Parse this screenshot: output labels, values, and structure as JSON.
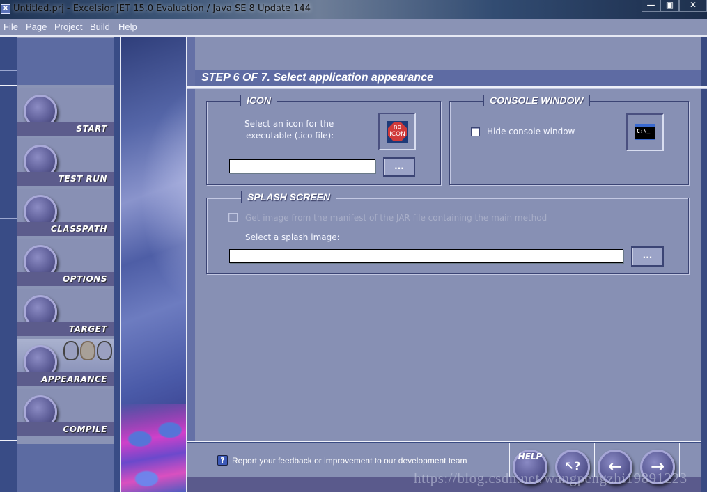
{
  "window": {
    "title": "Untitled.prj - Excelsior JET 15.0 Evaluation / Java SE 8 Update 144",
    "app_icon_glyph": "X",
    "controls": {
      "minimize": "—",
      "maximize": "▣",
      "close": "✕"
    }
  },
  "menu": [
    "File",
    "Page",
    "Project",
    "Build",
    "Help"
  ],
  "sidebar": {
    "items": [
      {
        "label": "START",
        "active": false
      },
      {
        "label": "TEST RUN",
        "active": false
      },
      {
        "label": "CLASSPATH",
        "active": false
      },
      {
        "label": "OPTIONS",
        "active": false
      },
      {
        "label": "TARGET",
        "active": false
      },
      {
        "label": "APPEARANCE",
        "active": true
      },
      {
        "label": "COMPILE",
        "active": false
      }
    ]
  },
  "step": {
    "title": "STEP 6 OF 7. Select application appearance"
  },
  "icon_group": {
    "legend": "ICON",
    "description_line1": "Select an icon for the",
    "description_line2": "executable (.ico file):",
    "preview_text_top": "no",
    "preview_text_bottom": "ICON",
    "path_value": "",
    "browse_label": "..."
  },
  "console_group": {
    "legend": "CONSOLE WINDOW",
    "hide_console_label": "Hide console window",
    "hide_console_checked": false,
    "preview_text": "C:\\_"
  },
  "splash_group": {
    "legend": "SPLASH SCREEN",
    "manifest_checkbox_label": "Get image from the manifest of the JAR file containing the main method",
    "manifest_checked": false,
    "manifest_enabled": false,
    "select_label": "Select a splash image:",
    "path_value": "",
    "browse_label": "..."
  },
  "footer": {
    "feedback_icon": "?",
    "feedback_text": "Report your feedback or improvement to our development team",
    "buttons": {
      "help": "HELP",
      "context_help": "↖?",
      "back": "←",
      "next": "→"
    }
  },
  "watermark": "https://blog.csdn.net/wangpengzhi19891223",
  "colors": {
    "panel": "#8790b4",
    "accent_dark": "#394a82",
    "step_bar": "#5e6ba3",
    "no_icon_red": "#d03a3a"
  }
}
